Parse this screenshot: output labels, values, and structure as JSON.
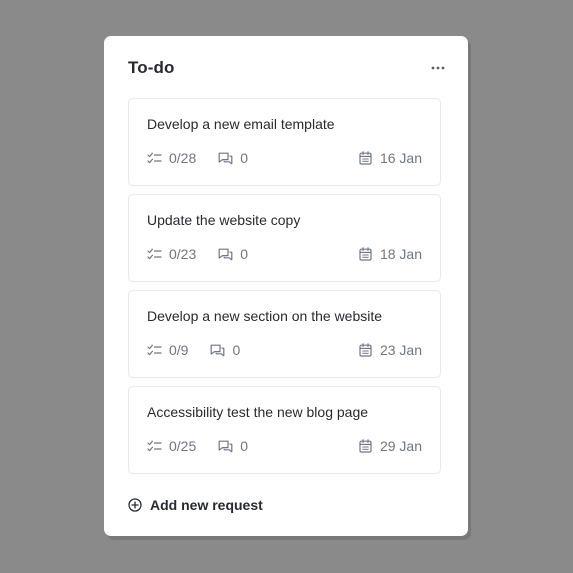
{
  "panel": {
    "title": "To-do",
    "more_icon": "ellipsis-icon"
  },
  "cards": [
    {
      "title": "Develop a new email template",
      "checklist": "0/28",
      "comments": "0",
      "date": "16 Jan"
    },
    {
      "title": "Update the website copy",
      "checklist": "0/23",
      "comments": "0",
      "date": "18 Jan"
    },
    {
      "title": "Develop a new section on the website",
      "checklist": "0/9",
      "comments": "0",
      "date": "23 Jan"
    },
    {
      "title": "Accessibility test the new blog page",
      "checklist": "0/25",
      "comments": "0",
      "date": "29 Jan"
    }
  ],
  "add_request": {
    "label": "Add new request",
    "icon": "plus-circle-icon"
  },
  "colors": {
    "background": "#8a8a8a",
    "panel": "#ffffff",
    "text_primary": "#262a33",
    "text_muted": "#6e7687",
    "card_border": "#e7e9ee"
  }
}
